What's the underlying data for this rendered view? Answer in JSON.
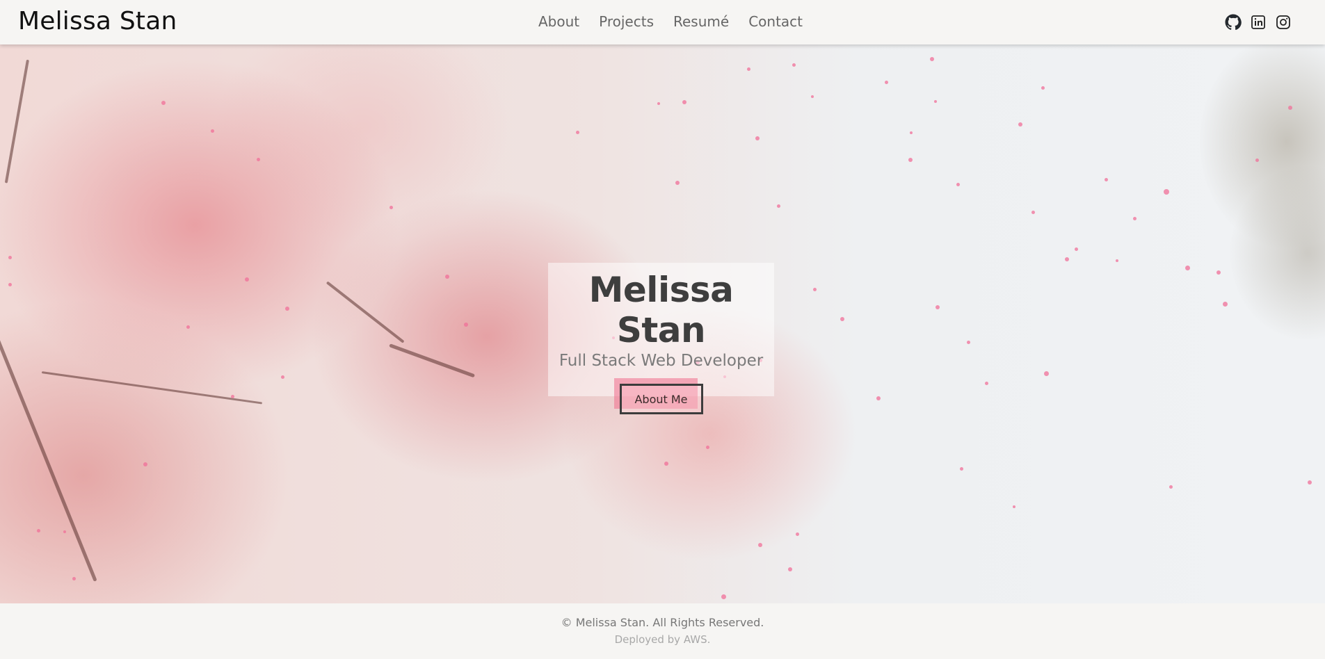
{
  "header": {
    "brand": "Melissa Stan",
    "nav": [
      {
        "label": "About"
      },
      {
        "label": "Projects"
      },
      {
        "label": "Resumé"
      },
      {
        "label": "Contact"
      }
    ],
    "social": [
      {
        "icon": "github-icon"
      },
      {
        "icon": "linkedin-icon"
      },
      {
        "icon": "instagram-icon"
      }
    ]
  },
  "hero": {
    "title": "Melissa Stan",
    "subtitle": "Full Stack Web Developer",
    "button_label": "About Me",
    "accent_color": "#f06f98"
  },
  "footer": {
    "copyright": "© Melissa Stan. All Rights Reserved.",
    "deployed": "Deployed by AWS."
  }
}
